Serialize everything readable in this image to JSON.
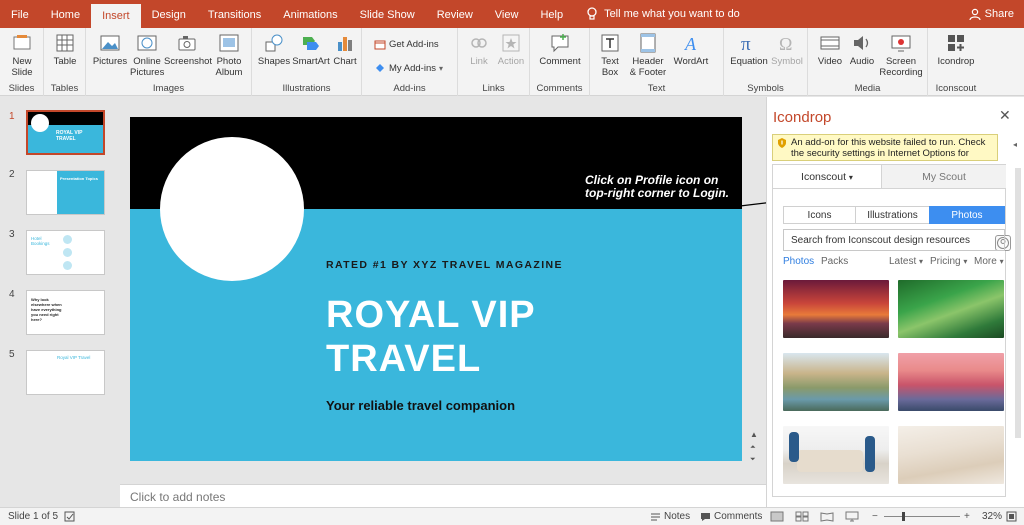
{
  "tabs": [
    "File",
    "Home",
    "Insert",
    "Design",
    "Transitions",
    "Animations",
    "Slide Show",
    "Review",
    "View",
    "Help"
  ],
  "active_tab": "Insert",
  "tell_me": "Tell me what you want to do",
  "share": "Share",
  "ribbon": {
    "slides": {
      "label": "Slides",
      "new_slide": "New",
      "new_slide2": "Slide"
    },
    "tables": {
      "label": "Tables",
      "table": "Table"
    },
    "images": {
      "label": "Images",
      "pictures": "Pictures",
      "online1": "Online",
      "online2": "Pictures",
      "screenshot": "Screenshot",
      "album1": "Photo",
      "album2": "Album"
    },
    "illustrations": {
      "label": "Illustrations",
      "shapes": "Shapes",
      "smartart": "SmartArt",
      "chart": "Chart"
    },
    "addins": {
      "label": "Add-ins",
      "get": "Get Add-ins",
      "my": "My Add-ins"
    },
    "links": {
      "label": "Links",
      "link": "Link",
      "action": "Action"
    },
    "comments": {
      "label": "Comments",
      "comment": "Comment"
    },
    "text": {
      "label": "Text",
      "textbox1": "Text",
      "textbox2": "Box",
      "hf1": "Header",
      "hf2": "& Footer",
      "wordart": "WordArt"
    },
    "symbols": {
      "label": "Symbols",
      "equation": "Equation",
      "symbol": "Symbol"
    },
    "media": {
      "label": "Media",
      "video": "Video",
      "audio": "Audio",
      "screen1": "Screen",
      "screen2": "Recording"
    },
    "iconscout": {
      "label": "Iconscout",
      "icondrop": "Icondrop"
    }
  },
  "thumbnails": {
    "numbers": [
      "1",
      "2",
      "3",
      "4",
      "5"
    ],
    "t1_title1": "ROYAL VIP",
    "t1_title2": "TRAVEL",
    "t2_title": "Presentation Topics",
    "t3_title1": "Hotel",
    "t3_title2": "Bookings",
    "t4_title1": "Why look",
    "t4_title2": "elsewhere when",
    "t4_title3": "have everything",
    "t4_title4": "you need right",
    "t4_title5": "here?",
    "t5_title": "Royal VIP Travel"
  },
  "slide": {
    "rated": "RATED #1 BY XYZ TRAVEL MAGAZINE",
    "title_line1": "ROYAL VIP",
    "title_line2": "TRAVEL",
    "subtitle": "Your reliable travel companion"
  },
  "callout": {
    "line1": "Click on Profile icon on",
    "line2": "top-right corner to Login."
  },
  "notes_placeholder": "Click to add notes",
  "pane": {
    "title": "Icondrop",
    "warning": "An add-on for this website failed to run. Check the security settings in Internet Options for potential ...",
    "nav_iconscout": "Iconscout",
    "nav_myscout": "My Scout",
    "segments": [
      "Icons",
      "Illustrations",
      "Photos"
    ],
    "active_segment": "Photos",
    "search_placeholder": "Search from Iconscout design resources",
    "filter_photos": "Photos",
    "filter_packs": "Packs",
    "filter_latest": "Latest",
    "filter_pricing": "Pricing",
    "filter_more": "More"
  },
  "status": {
    "slide_of": "Slide 1 of 5",
    "notes": "Notes",
    "comments": "Comments",
    "zoom": "32%"
  },
  "colors": {
    "accent": "#c3472a",
    "slide_blue": "#3ab7dc",
    "link_blue": "#3d8ef0"
  }
}
